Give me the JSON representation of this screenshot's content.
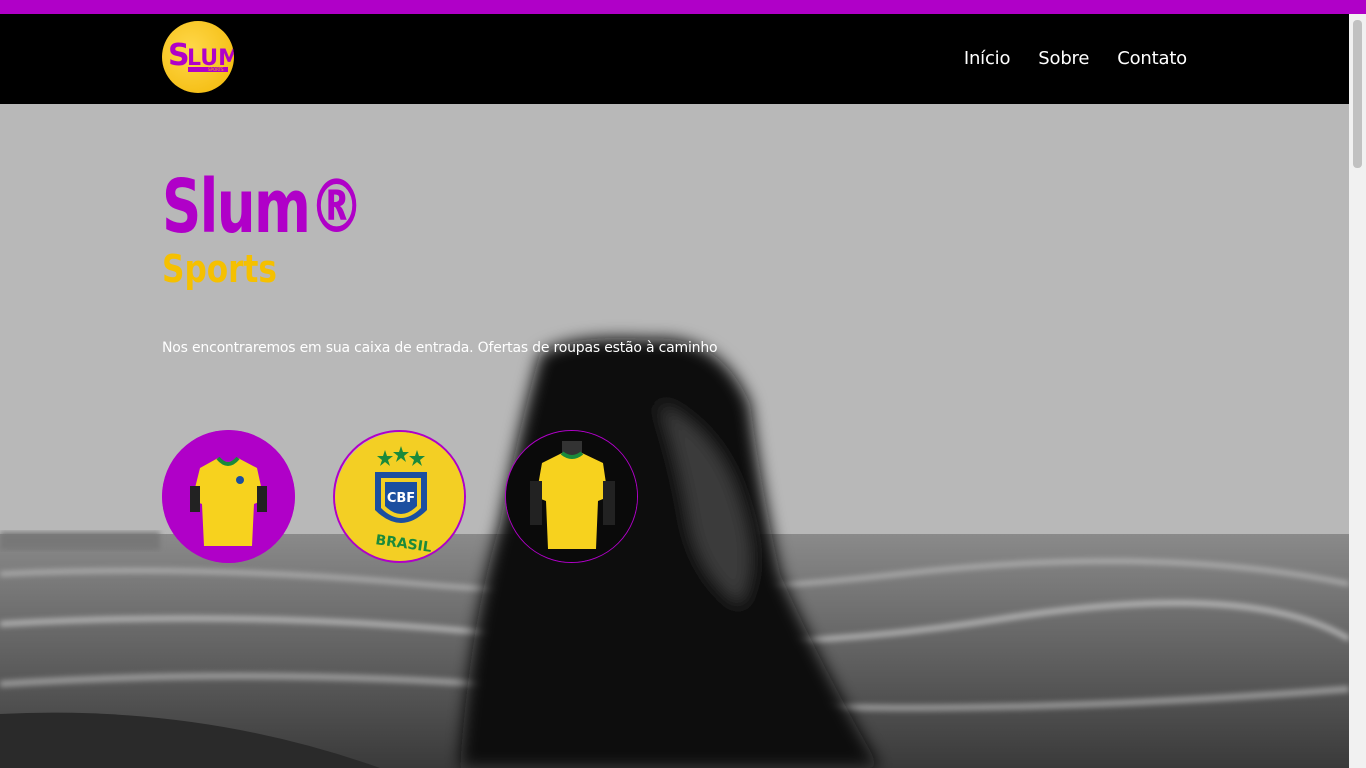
{
  "header": {
    "logo_lettering": "SLUM SPORTS",
    "nav": [
      {
        "label": "Início"
      },
      {
        "label": "Sobre"
      },
      {
        "label": "Contato"
      }
    ]
  },
  "hero": {
    "title": "Slum®",
    "subtitle": "Sports",
    "tagline": "Nos encontraremos em sua caixa de entrada. Ofertas de roupas estão à caminho",
    "products": [
      {
        "icon": "jersey-front-icon"
      },
      {
        "icon": "cbf-crest-icon",
        "text": "BRASIL"
      },
      {
        "icon": "jersey-back-icon"
      }
    ]
  },
  "colors": {
    "accent_purple": "#b000c8",
    "accent_yellow": "#f5c000",
    "header_bg": "#000000"
  }
}
